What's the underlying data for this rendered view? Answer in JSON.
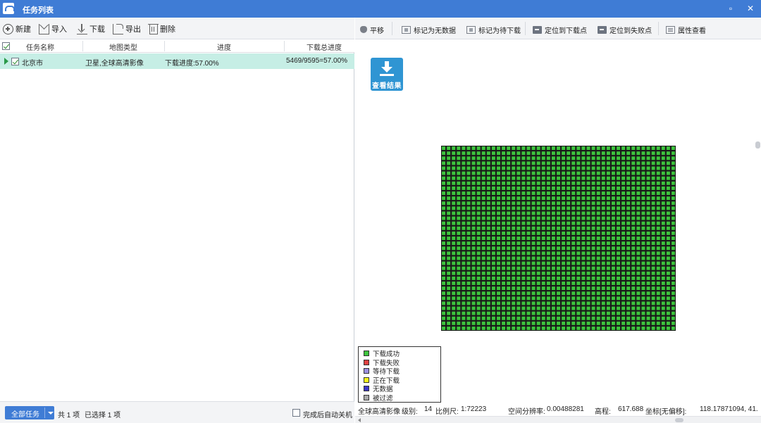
{
  "window": {
    "title": "任务列表",
    "controls": [
      "▫",
      "✕"
    ]
  },
  "toolbar": {
    "new_label": "新建",
    "import_label": "导入",
    "download_label": "下载",
    "export_label": "导出",
    "delete_label": "删除"
  },
  "table": {
    "headers": [
      "任务名称",
      "地图类型",
      "进度",
      "下载总进度"
    ],
    "rows": [
      {
        "name": "北京市",
        "map_type": "卫星,全球高清影像",
        "progress": "下载进度:57.00%",
        "total": "5469/9595=57.00%",
        "checked": true,
        "selected": true
      }
    ]
  },
  "left_status": {
    "all_tasks_label": "全部任务",
    "count_text": "共 1 项",
    "selected_text": "已选择 1 项",
    "auto_shutdown_label": "完成后自动关机",
    "auto_shutdown_checked": false
  },
  "map_toolbar": {
    "pan_label": "平移",
    "mark_no_data_label": "标记为无数据",
    "mark_pending_label": "标记为待下载",
    "locate_download_label": "定位到下载点",
    "locate_fail_label": "定位到失败点",
    "properties_label": "属性查看"
  },
  "view_result_label": "查看结果",
  "tiles": {
    "cols": 47,
    "rows": 37,
    "status": "下载成功",
    "color": "#3dc43d"
  },
  "legend": [
    {
      "label": "下载成功",
      "color": "#3dc43d"
    },
    {
      "label": "下载失败",
      "color": "#e04040"
    },
    {
      "label": "等待下载",
      "color": "#9a8ee0"
    },
    {
      "label": "正在下载",
      "color": "#f5f51a"
    },
    {
      "label": "无数据",
      "color": "#3a35c8"
    },
    {
      "label": "被过滤",
      "color": "#a8a8a8"
    }
  ],
  "map_status": {
    "layer": "全球高清影像",
    "level_label": "级别:",
    "level_value": "14",
    "scale_label": "比例尺:",
    "scale_value": "1:72223",
    "resolution_label": "空间分辨率:",
    "resolution_value": "0.00488281",
    "elevation_label": "高程:",
    "elevation_value": "617.688",
    "coord_label": "坐标[无偏移]:",
    "coord_value": "118.17871094, 41."
  },
  "colors": {
    "accent": "#3f7cd5",
    "row_selected": "#c6eee5",
    "view_result": "#2f95d3"
  }
}
